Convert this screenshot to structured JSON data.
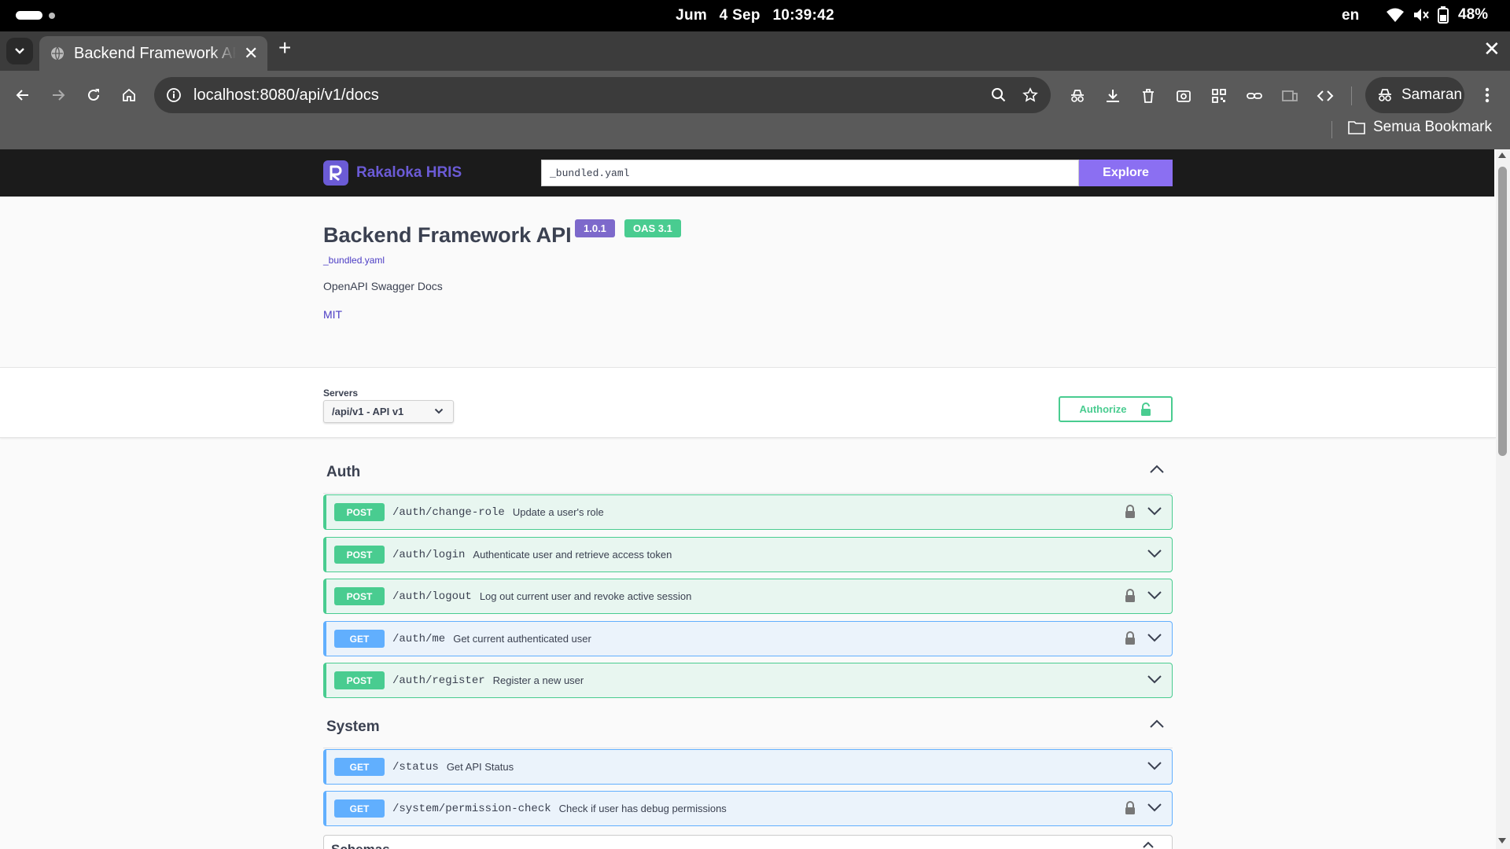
{
  "status_bar": {
    "day": "Jum",
    "date": "4 Sep",
    "time": "10:39:42",
    "lang": "en",
    "battery": "48%"
  },
  "browser": {
    "tab_title": "Backend Framework API",
    "url": "localhost:8080/api/v1/docs",
    "profile": "Samaran",
    "bookmarks_label": "Semua Bookmark"
  },
  "swagger": {
    "brand": "Rakaloka HRIS",
    "spec_url": "_bundled.yaml",
    "explore_label": "Explore",
    "title": "Backend Framework API",
    "version": "1.0.1",
    "oas": "OAS 3.1",
    "spec_link": "_bundled.yaml",
    "description": "OpenAPI Swagger Docs",
    "license": "MIT",
    "servers_label": "Servers",
    "server_selected": "/api/v1 - API v1",
    "authorize_label": "Authorize"
  },
  "tags": [
    {
      "name": "Auth",
      "operations": [
        {
          "method": "POST",
          "path": "/auth/change-role",
          "summary": "Update a user's role",
          "locked": true
        },
        {
          "method": "POST",
          "path": "/auth/login",
          "summary": "Authenticate user and retrieve access token",
          "locked": false
        },
        {
          "method": "POST",
          "path": "/auth/logout",
          "summary": "Log out current user and revoke active session",
          "locked": true
        },
        {
          "method": "GET",
          "path": "/auth/me",
          "summary": "Get current authenticated user",
          "locked": true
        },
        {
          "method": "POST",
          "path": "/auth/register",
          "summary": "Register a new user",
          "locked": false
        }
      ]
    },
    {
      "name": "System",
      "operations": [
        {
          "method": "GET",
          "path": "/status",
          "summary": "Get API Status",
          "locked": false
        },
        {
          "method": "GET",
          "path": "/system/permission-check",
          "summary": "Check if user has debug permissions",
          "locked": true
        }
      ]
    }
  ],
  "models_label": "Schemas",
  "colors": {
    "post": "#49cc90",
    "get": "#61affe",
    "brand": "#6b5bd6",
    "explore": "#8b6ff2",
    "version_badge": "#7d69cb"
  }
}
